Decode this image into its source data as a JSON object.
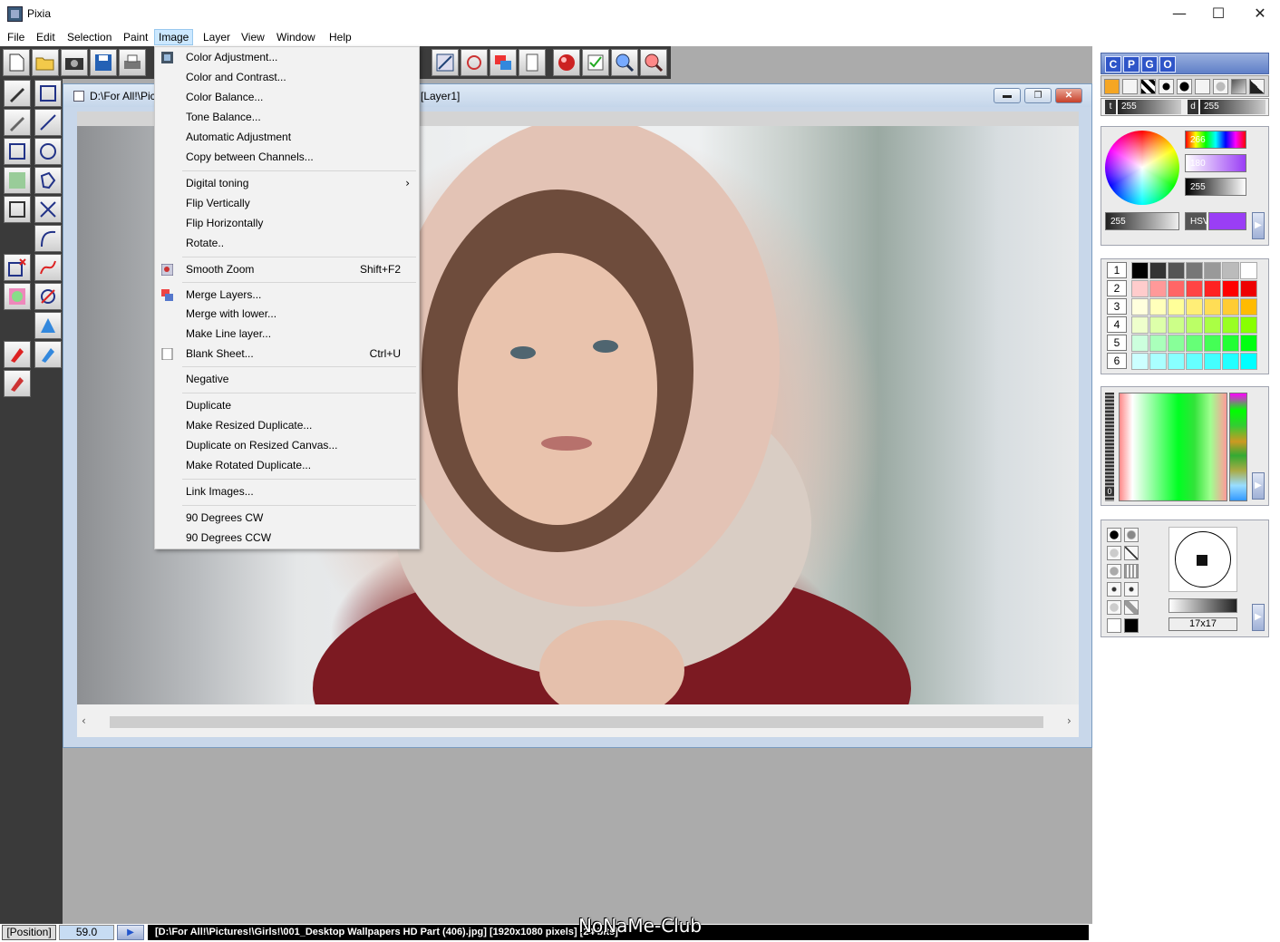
{
  "window": {
    "title": "Pixia",
    "minimize": "—",
    "maximize": "☐",
    "close": "✕"
  },
  "menubar": [
    "File",
    "Edit",
    "Selection",
    "Paint",
    "Image",
    "Layer",
    "View",
    "Window",
    "Help"
  ],
  "document": {
    "title_left": "D:\\For All!\\Pic",
    "title_right": "[Layer1]",
    "btn_min": "▬",
    "btn_max": "❐",
    "btn_close": "✕"
  },
  "image_menu": {
    "items": [
      {
        "label": "Color Adjustment...",
        "icon": "color-adjust-icon"
      },
      {
        "label": "Color and Contrast..."
      },
      {
        "label": "Color Balance..."
      },
      {
        "label": "Tone Balance..."
      },
      {
        "label": "Automatic Adjustment"
      },
      {
        "label": "Copy between Channels..."
      },
      {
        "label": "Digital toning",
        "submenu": "›"
      },
      {
        "label": "Flip Vertically"
      },
      {
        "label": "Flip Horizontally"
      },
      {
        "label": "Rotate.."
      },
      {
        "label": "Smooth Zoom",
        "shortcut": "Shift+F2",
        "icon": "smooth-zoom-icon"
      },
      {
        "label": "Merge Layers...",
        "icon": "merge-layers-icon"
      },
      {
        "label": "Merge with lower..."
      },
      {
        "label": "Make Line layer..."
      },
      {
        "label": "Blank Sheet...",
        "shortcut": "Ctrl+U",
        "icon": "blank-sheet-icon"
      },
      {
        "label": "Negative"
      },
      {
        "label": "Duplicate"
      },
      {
        "label": "Make Resized Duplicate..."
      },
      {
        "label": "Duplicate on Resized Canvas..."
      },
      {
        "label": "Make Rotated Duplicate..."
      },
      {
        "label": "Link Images..."
      },
      {
        "label": "90 Degrees CW"
      },
      {
        "label": "90 Degrees CCW"
      }
    ]
  },
  "panel_tabs": [
    "C",
    "P",
    "G",
    "O"
  ],
  "td_values": {
    "t_label": "t",
    "t_value": "255",
    "d_label": "d",
    "d_value": "255"
  },
  "color_panel": {
    "hue": "266",
    "saturation": "180",
    "value": "255",
    "alpha": "255",
    "mode": "HSV"
  },
  "palette_rows": [
    "1",
    "2",
    "3",
    "4",
    "5",
    "6"
  ],
  "brush": {
    "size": "17x17"
  },
  "gradient": {
    "ruler_label": "0"
  },
  "status": {
    "position_label": "[Position]",
    "position_value": "59.0",
    "path": "[D:\\For All!\\Pictures!\\Girls!\\001_Desktop Wallpapers  HD Part (406).jpg] [1920x1080 pixels] [24 bits]"
  },
  "watermark": "NoNaMe-Club"
}
